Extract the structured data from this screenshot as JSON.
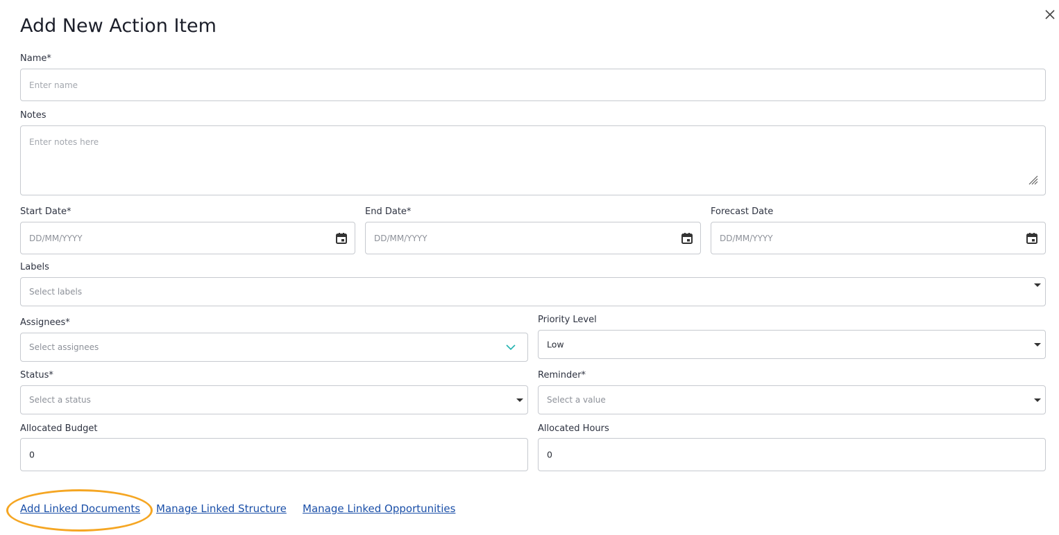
{
  "dialog": {
    "title": "Add New Action Item",
    "close_icon": "close-icon"
  },
  "form": {
    "name": {
      "label": "Name*",
      "placeholder": "Enter name"
    },
    "notes": {
      "label": "Notes",
      "placeholder": "Enter notes here"
    },
    "start_date": {
      "label": "Start Date*",
      "placeholder": "DD/MM/YYYY"
    },
    "end_date": {
      "label": "End Date*",
      "placeholder": "DD/MM/YYYY"
    },
    "forecast_date": {
      "label": "Forecast Date",
      "placeholder": "DD/MM/YYYY"
    },
    "labels": {
      "label": "Labels",
      "placeholder": "Select labels"
    },
    "assignees": {
      "label": "Assignees*",
      "placeholder": "Select assignees"
    },
    "priority": {
      "label": "Priority Level",
      "value": "Low"
    },
    "status": {
      "label": "Status*",
      "placeholder": "Select a status"
    },
    "reminder": {
      "label": "Reminder*",
      "placeholder": "Select a value"
    },
    "budget": {
      "label": "Allocated Budget",
      "value": "0"
    },
    "hours": {
      "label": "Allocated Hours",
      "value": "0"
    }
  },
  "links": {
    "add_linked_documents": "Add Linked Documents",
    "manage_linked_structure": "Manage Linked Structure",
    "manage_linked_opportunities": "Manage Linked Opportunities"
  },
  "colors": {
    "link": "#1a4fa8",
    "highlight": "#f5a623",
    "assignee_chevron": "#22b3b0"
  }
}
